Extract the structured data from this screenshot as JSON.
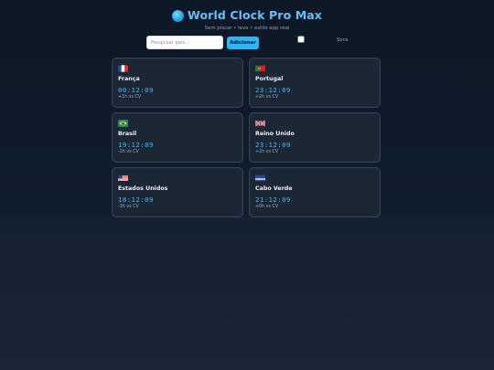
{
  "app": {
    "title": "World Clock Pro Max",
    "subtitle": "Sem piscar • leve • estilo app real"
  },
  "controls": {
    "search_placeholder": "Pesquisar país...",
    "add_button": "Adicionar",
    "sound_label": "Sons",
    "sound_checked": false
  },
  "clocks": [
    {
      "country": "França",
      "time": "00:12:09",
      "offset": "+1h vs CV",
      "flag": "france-flag"
    },
    {
      "country": "Portugal",
      "time": "23:12:09",
      "offset": "+2h vs CV",
      "flag": "portugal-flag"
    },
    {
      "country": "Brasil",
      "time": "19:12:09",
      "offset": "-2h vs CV",
      "flag": "brazil-flag"
    },
    {
      "country": "Reino Unido",
      "time": "23:12:09",
      "offset": "+2h vs CV",
      "flag": "united-kingdom-flag"
    },
    {
      "country": "Estados Unidos",
      "time": "18:12:09",
      "offset": "-3h vs CV",
      "flag": "united-states-flag"
    },
    {
      "country": "Cabo Verde",
      "time": "21:12:09",
      "offset": "+0h vs CV",
      "flag": "cape-verde-flag"
    }
  ],
  "colors": {
    "accent": "#64c0f7",
    "time": "#3bb8ff",
    "button": "#2ab7f6",
    "background": "#0d1826"
  }
}
